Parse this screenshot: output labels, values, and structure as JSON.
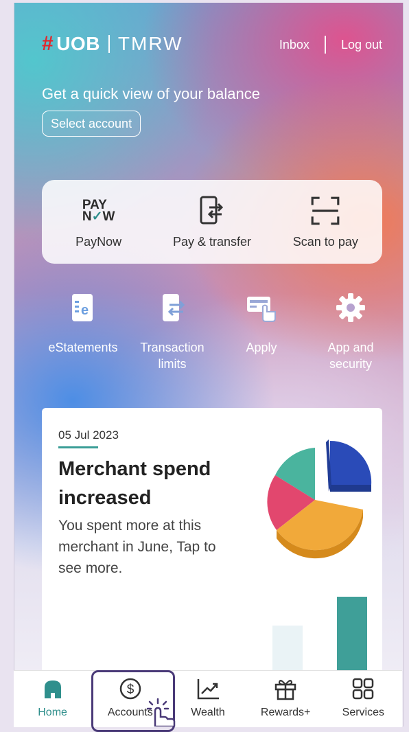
{
  "header": {
    "logo_brand": "UOB",
    "logo_product": "TMRW",
    "inbox_label": "Inbox",
    "logout_label": "Log out"
  },
  "balance": {
    "prompt": "Get a quick view of your balance",
    "select_label": "Select account"
  },
  "quick_actions": [
    {
      "label": "PayNow",
      "icon": "paynow-icon"
    },
    {
      "label": "Pay & transfer",
      "icon": "pay-transfer-icon"
    },
    {
      "label": "Scan to pay",
      "icon": "scan-icon"
    }
  ],
  "shortcuts": [
    {
      "label": "eStatements",
      "icon": "estatement-icon"
    },
    {
      "label": "Transaction limits",
      "icon": "transaction-limits-icon"
    },
    {
      "label": "Apply",
      "icon": "apply-icon"
    },
    {
      "label": "App and security",
      "icon": "gear-icon"
    }
  ],
  "promo": {
    "date": "05 Jul 2023",
    "title": "Merchant spend increased",
    "description": "You spent more at this merchant in June, Tap to see more."
  },
  "bottom_nav": [
    {
      "label": "Home",
      "icon": "home-icon",
      "active": true
    },
    {
      "label": "Accounts",
      "icon": "dollar-icon",
      "active": false
    },
    {
      "label": "Wealth",
      "icon": "chart-icon",
      "active": false
    },
    {
      "label": "Rewards+",
      "icon": "gift-icon",
      "active": false
    },
    {
      "label": "Services",
      "icon": "grid-icon",
      "active": false
    }
  ],
  "colors": {
    "accent": "#2f8f8c",
    "brand_red": "#e3262b",
    "highlight_border": "#4a3a78"
  }
}
